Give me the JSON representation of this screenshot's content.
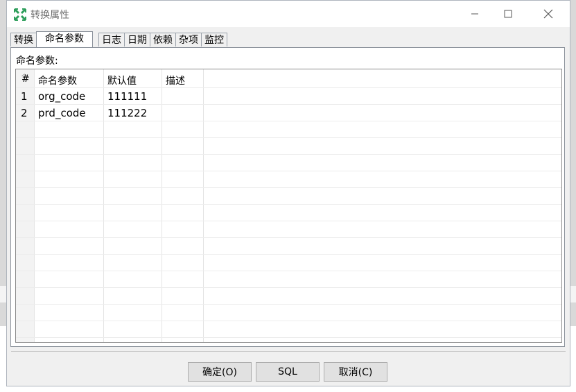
{
  "dialog": {
    "title": "转换属性",
    "window_controls": [
      "minimize-icon",
      "maximize-icon",
      "close-icon"
    ]
  },
  "tabs": [
    {
      "label": "转换"
    },
    {
      "label": "命名参数"
    },
    {
      "label": "日志"
    },
    {
      "label": "日期"
    },
    {
      "label": "依赖"
    },
    {
      "label": "杂项"
    },
    {
      "label": "监控"
    }
  ],
  "active_tab": "命名参数",
  "panel": {
    "label": "命名参数:"
  },
  "table": {
    "columns": [
      "#",
      "命名参数",
      "默认值",
      "描述"
    ],
    "rows": [
      {
        "index": "1",
        "name": "org_code",
        "default": "111111",
        "desc": ""
      },
      {
        "index": "2",
        "name": "prd_code",
        "default": "111222",
        "desc": ""
      }
    ]
  },
  "buttons": {
    "ok": "确定(O)",
    "sql": "SQL",
    "cancel": "取消(C)"
  },
  "colors": {
    "accent_icon": "#2e9e5b",
    "dialog_bg": "#f0f0f0",
    "button_bg": "#e1e1e1"
  }
}
